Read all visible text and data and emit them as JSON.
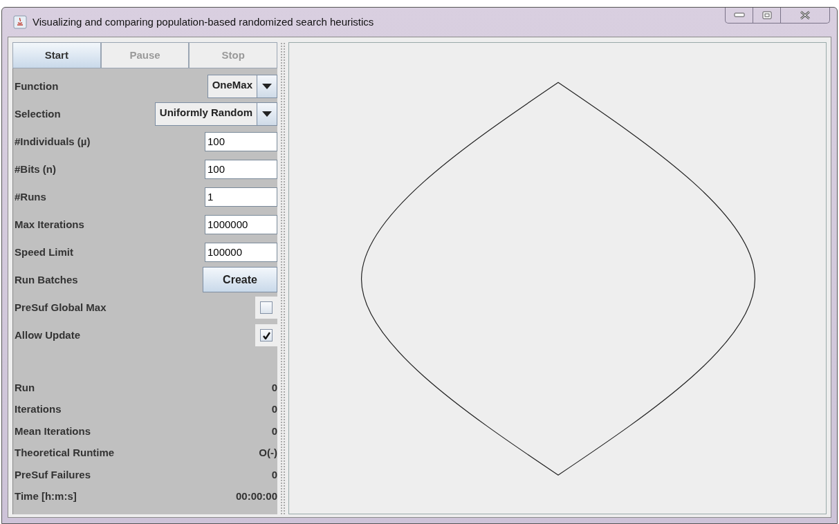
{
  "window": {
    "title": "Visualizing and comparing population-based randomized search heuristics"
  },
  "controls": [
    {
      "label": "Start",
      "selected": true,
      "disabled": false
    },
    {
      "label": "Pause",
      "selected": false,
      "disabled": true
    },
    {
      "label": "Stop",
      "selected": false,
      "disabled": true
    }
  ],
  "settings": [
    {
      "kind": "dropdown",
      "label": "Function",
      "value": "OneMax"
    },
    {
      "kind": "dropdown",
      "label": "Selection",
      "value": "Uniformly Random"
    },
    {
      "kind": "text",
      "label": "#Individuals (µ)",
      "value": "100"
    },
    {
      "kind": "text",
      "label": "#Bits (n)",
      "value": "100"
    },
    {
      "kind": "text",
      "label": "#Runs",
      "value": "1"
    },
    {
      "kind": "text",
      "label": "Max Iterations",
      "value": "1000000"
    },
    {
      "kind": "text",
      "label": "Speed Limit",
      "value": "100000"
    },
    {
      "kind": "button",
      "label": "Run Batches",
      "value": "Create"
    },
    {
      "kind": "checkbox",
      "label": "PreSuf Global Max",
      "checked": false
    },
    {
      "kind": "checkbox",
      "label": "Allow Update",
      "checked": true
    }
  ],
  "stats": [
    {
      "label": "Run",
      "value": "0"
    },
    {
      "label": "Iterations",
      "value": "0"
    },
    {
      "label": "Mean Iterations",
      "value": "0"
    },
    {
      "label": "Theoretical Runtime",
      "value": "O(-)"
    },
    {
      "label": "PreSuf Failures",
      "value": "0"
    },
    {
      "label": "Time [h:m:s]",
      "value": "00:00:00"
    }
  ]
}
